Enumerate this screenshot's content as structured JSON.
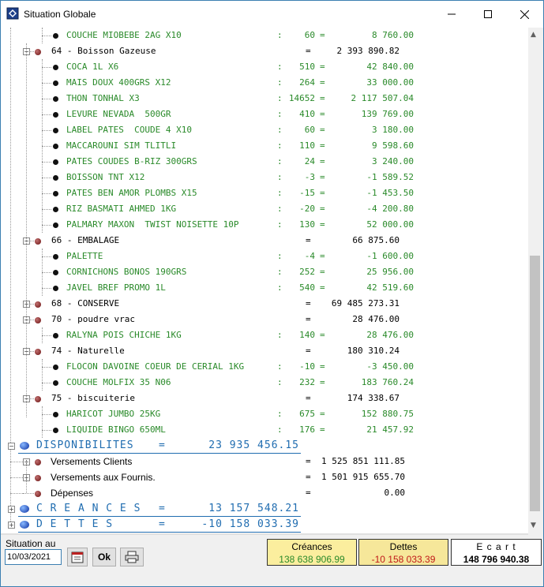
{
  "window": {
    "title": "Situation Globale"
  },
  "tree": [
    {
      "kind": "item",
      "name": "COUCHE MIOBEBE 2AG X10",
      "colon": ":",
      "qty": "60",
      "eq": "=",
      "amount": "8 760.00"
    },
    {
      "kind": "group",
      "name": "64 - Boisson Gazeuse",
      "eq": "=",
      "amount": "2 393 890.82"
    },
    {
      "kind": "item",
      "name": "COCA 1L X6",
      "colon": ":",
      "qty": "510",
      "eq": "=",
      "amount": "42 840.00"
    },
    {
      "kind": "item",
      "name": "MAIS DOUX 400GRS X12",
      "colon": ":",
      "qty": "264",
      "eq": "=",
      "amount": "33 000.00"
    },
    {
      "kind": "item",
      "name": "THON TONHAL X3",
      "colon": ":",
      "qty": "14652",
      "eq": "=",
      "amount": "2 117 507.04"
    },
    {
      "kind": "item",
      "name": "LEVURE NEVADA  500GR",
      "colon": ":",
      "qty": "410",
      "eq": "=",
      "amount": "139 769.00"
    },
    {
      "kind": "item",
      "name": "LABEL PATES  COUDE 4 X10",
      "colon": ":",
      "qty": "60",
      "eq": "=",
      "amount": "3 180.00"
    },
    {
      "kind": "item",
      "name": "MACCAROUNI SIM TLITLI",
      "colon": ":",
      "qty": "110",
      "eq": "=",
      "amount": "9 598.60"
    },
    {
      "kind": "item",
      "name": "PATES COUDES B-RIZ 300GRS",
      "colon": ":",
      "qty": "24",
      "eq": "=",
      "amount": "3 240.00"
    },
    {
      "kind": "item",
      "name": "BOISSON TNT X12",
      "colon": ":",
      "qty": "-3",
      "eq": "=",
      "amount": "-1 589.52"
    },
    {
      "kind": "item",
      "name": "PATES BEN AMOR PLOMBS X15",
      "colon": ":",
      "qty": "-15",
      "eq": "=",
      "amount": "-1 453.50"
    },
    {
      "kind": "item",
      "name": "RIZ BASMATI AHMED 1KG",
      "colon": ":",
      "qty": "-20",
      "eq": "=",
      "amount": "-4 200.80"
    },
    {
      "kind": "item",
      "name": "PALMARY MAXON  TWIST NOISETTE 10P",
      "colon": ":",
      "qty": "130",
      "eq": "=",
      "amount": "52 000.00"
    },
    {
      "kind": "group",
      "name": "66 - EMBALAGE",
      "eq": "=",
      "amount": "66 875.60"
    },
    {
      "kind": "item",
      "name": "PALETTE",
      "colon": ":",
      "qty": "-4",
      "eq": "=",
      "amount": "-1 600.00"
    },
    {
      "kind": "item",
      "name": "CORNICHONS BONOS 190GRS",
      "colon": ":",
      "qty": "252",
      "eq": "=",
      "amount": "25 956.00"
    },
    {
      "kind": "item",
      "name": "JAVEL BREF PROMO 1L",
      "colon": ":",
      "qty": "540",
      "eq": "=",
      "amount": "42 519.60"
    },
    {
      "kind": "group",
      "collapsed": true,
      "name": "68 - CONSERVE",
      "eq": "=",
      "amount": "69 485 273.31"
    },
    {
      "kind": "group",
      "name": "70 - poudre vrac",
      "eq": "=",
      "amount": "28 476.00"
    },
    {
      "kind": "item",
      "name": "RALYNA POIS CHICHE 1KG",
      "colon": ":",
      "qty": "140",
      "eq": "=",
      "amount": "28 476.00"
    },
    {
      "kind": "group",
      "name": "74 - Naturelle",
      "eq": "=",
      "amount": "180 310.24"
    },
    {
      "kind": "item",
      "name": "FLOCON DAVOINE COEUR DE CERIAL 1KG",
      "colon": ":",
      "qty": "-10",
      "eq": "=",
      "amount": "-3 450.00"
    },
    {
      "kind": "item",
      "name": "COUCHE MOLFIX 35 N06",
      "colon": ":",
      "qty": "232",
      "eq": "=",
      "amount": "183 760.24"
    },
    {
      "kind": "group",
      "name": "75 - biscuiterie",
      "eq": "=",
      "amount": "174 338.67"
    },
    {
      "kind": "item",
      "name": "HARICOT JUMBO 25KG",
      "colon": ":",
      "qty": "675",
      "eq": "=",
      "amount": "152 880.75"
    },
    {
      "kind": "item",
      "name": "LIQUIDE BINGO 650ML",
      "colon": ":",
      "qty": "176",
      "eq": "=",
      "amount": "21 457.92"
    },
    {
      "kind": "top",
      "name": "DISPONIBILITES",
      "eq": "=",
      "amount": "23 935 456.15"
    },
    {
      "kind": "sub",
      "collapsed": true,
      "name": "Versements Clients",
      "eq": "=",
      "amount": "1 525 851 111.85"
    },
    {
      "kind": "sub",
      "collapsed": true,
      "name": "Versements aux Fournis.",
      "eq": "=",
      "amount": "1 501 915 655.70"
    },
    {
      "kind": "sub",
      "collapsed": false,
      "name": "Dépenses",
      "eq": "=",
      "amount": "0.00"
    },
    {
      "kind": "top",
      "collapsed": true,
      "name": "C R E A N C E S",
      "eq": "=",
      "amount": "13 157 548.21"
    },
    {
      "kind": "top",
      "collapsed": true,
      "name": "D E T T E S",
      "eq": "=",
      "amount": "-10 158 033.39"
    }
  ],
  "footer": {
    "situation_label": "Situation au",
    "date_value": "10/03/2021",
    "ok_label": "Ok",
    "creances_title": "Créances",
    "creances_value": "138 638 906.99",
    "dettes_title": "Dettes",
    "dettes_value": "-10 158 033.39",
    "ecart_title": "E c a r t",
    "ecart_value": "148 796 940.38"
  },
  "colors": {
    "item_text": "#2a8a2a",
    "totals_blue": "#1f6cb0",
    "creances_bg": "#fbee9e",
    "creances_value": "#2a8a2a",
    "dettes_bg": "#f6e79a",
    "dettes_value": "#c01818"
  }
}
